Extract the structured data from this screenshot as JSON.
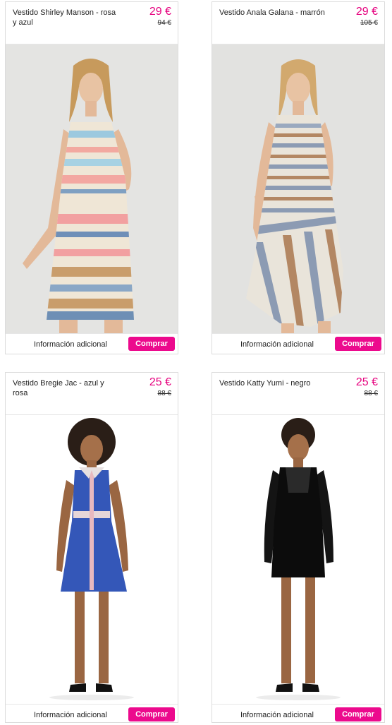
{
  "products": [
    {
      "title": "Vestido Shirley Manson - rosa y azul",
      "price": "29 €",
      "old_price": "94 €",
      "image_alt": "Vestido Shirley Manson",
      "more_info_label": "Información adicional",
      "buy_label": "Comprar"
    },
    {
      "title": "Vestido Anala Galana - marrón",
      "price": "29 €",
      "old_price": "105 €",
      "image_alt": "Vestido Anala Galana",
      "more_info_label": "Información adicional",
      "buy_label": "Comprar"
    },
    {
      "title": "Vestido Bregie Jac - azul y rosa",
      "price": "25 €",
      "old_price": "88 €",
      "image_alt": "Vestido Bregie Jac",
      "more_info_label": "Información adicional",
      "buy_label": "Comprar"
    },
    {
      "title": "Vestido Katty Yumi - negro",
      "price": "25 €",
      "old_price": "88 €",
      "image_alt": "Vestido Katty Yumi",
      "more_info_label": "Información adicional",
      "buy_label": "Comprar"
    }
  ],
  "colors": {
    "accent": "#ec0a8d",
    "price": "#e6007e"
  }
}
